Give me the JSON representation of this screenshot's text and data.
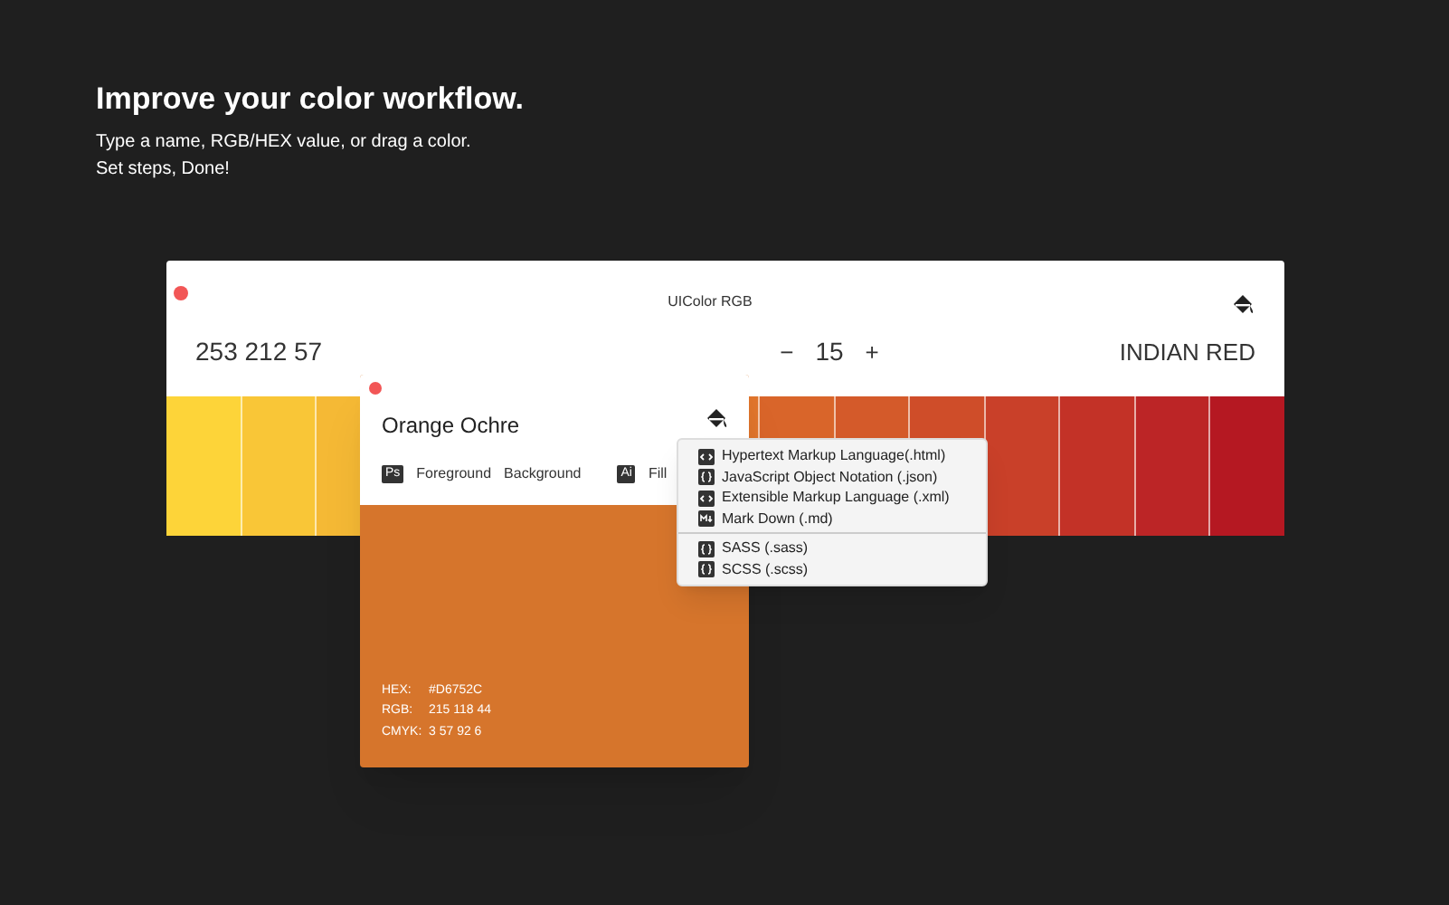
{
  "heading": {
    "title": "Improve your color workflow.",
    "lines": [
      "Type a name, RGB/HEX value, or drag a color.",
      "Set steps, Done!"
    ]
  },
  "window": {
    "title": "UIColor RGB",
    "start_value": "253 212 57",
    "stepper": {
      "minus": "−",
      "count": "15",
      "plus": "+"
    },
    "end_value": "INDIAN RED",
    "swatches_left": [
      {
        "color": "#fdd439"
      },
      {
        "color": "#f9c637"
      },
      {
        "color": "#f5b935"
      }
    ],
    "swatches_right": [
      {
        "color": "#e0752c"
      },
      {
        "color": "#d9652a"
      },
      {
        "color": "#d45a2a"
      },
      {
        "color": "#cf4d29"
      },
      {
        "color": "#c94029"
      },
      {
        "color": "#c33227"
      },
      {
        "color": "#bc2526"
      },
      {
        "color": "#b51822"
      }
    ]
  },
  "popup": {
    "name": "Orange Ochre",
    "color": "#d6752c",
    "ps": {
      "badge": "Ps",
      "options": [
        "Foreground",
        "Background"
      ]
    },
    "ai": {
      "badge": "Ai",
      "options": [
        "Fill"
      ]
    },
    "details": [
      {
        "label": "HEX:",
        "value": "#D6752C"
      },
      {
        "label": "RGB:",
        "value": "215 118 44"
      },
      {
        "label": "CMYK:",
        "value": "3 57 92 6"
      }
    ]
  },
  "menu": {
    "groups": [
      {
        "items": [
          {
            "kind": "code",
            "label": "Hypertext Markup Language(.html)"
          },
          {
            "kind": "braces",
            "label": "JavaScript Object Notation (.json)"
          },
          {
            "kind": "code",
            "label": "Extensible Markup Language (.xml)"
          },
          {
            "kind": "markdown",
            "label": "Mark Down (.md)"
          }
        ]
      },
      {
        "items": [
          {
            "kind": "braces",
            "label": "SASS (.sass)"
          },
          {
            "kind": "braces",
            "label": "SCSS (.scss)"
          }
        ]
      }
    ]
  }
}
